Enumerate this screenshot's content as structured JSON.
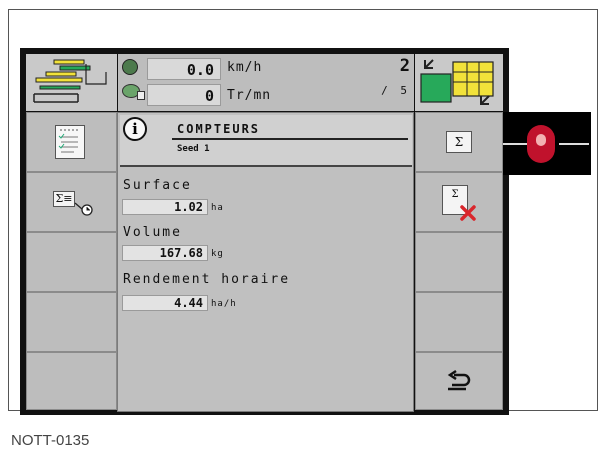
{
  "header": {
    "speed_value": "0.0",
    "speed_unit": "km/h",
    "rpm_value": "0",
    "rpm_unit": "Tr/mn",
    "page_current": "2",
    "page_total": "/ 5"
  },
  "panel": {
    "title": "COMPTEURS",
    "subtitle": "Seed 1",
    "fields": [
      {
        "label": "Surface",
        "value": "1.02",
        "unit": "ha"
      },
      {
        "label": "Volume",
        "value": "167.68",
        "unit": "kg"
      },
      {
        "label": "Rendement horaire",
        "value": "4.44",
        "unit": "ha/h"
      }
    ]
  },
  "softkeys": {
    "sum_label": "Σ",
    "sum_clear_label": "Σ"
  },
  "caption": "NOTT-0135",
  "colors": {
    "accent_yellow": "#f2e23a",
    "accent_green": "#27a95a",
    "mouse_red": "#c0122c",
    "delete_red": "#d9262c"
  }
}
